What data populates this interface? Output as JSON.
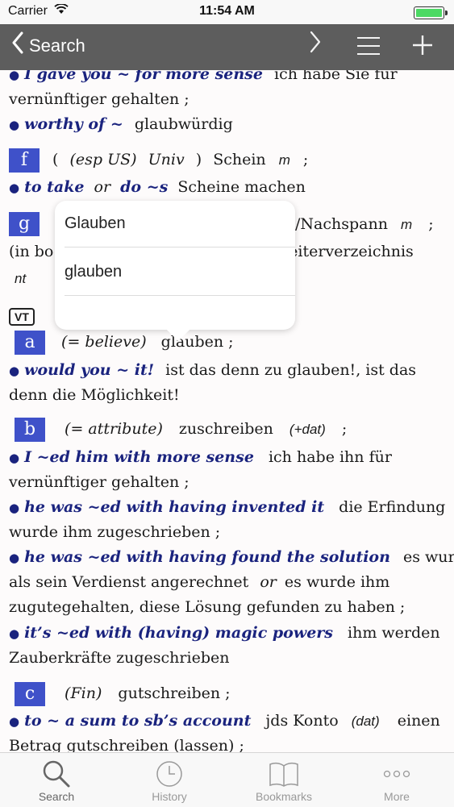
{
  "status": {
    "carrier": "Carrier",
    "time": "11:54 AM"
  },
  "nav": {
    "back_label": "Search"
  },
  "content": {
    "l1_en": "I gave you ~ for more sense",
    "l1_de": "ich habe Sie für",
    "l2": "vernünftiger gehalten ;",
    "l3_en": "worthy of ~",
    "l3_de": "glaubwürdig",
    "f_badge": "f",
    "f_paren_open": "(",
    "f_esp": "(esp US)",
    "f_univ": "Univ",
    "f_paren_close": ")",
    "f_word": "Schein",
    "f_gender": "m",
    "f_semi": ";",
    "l5_en1": "to take",
    "l5_or": "or",
    "l5_en2": "do ~s",
    "l5_de": "Scheine machen",
    "g_badge": "g",
    "g_text": "/Nachspann",
    "g_gender": "m",
    "g_semi": ";",
    "l7_left": "(in bo",
    "l7_right": "beiterverzeichnis",
    "l8": "nt",
    "vt_label": "VT",
    "a_badge": "a",
    "a_paren": "(= believe)",
    "a_word": "glauben ;",
    "l10_en": "would you ~ it!",
    "l10_de": "ist das denn zu glauben!, ist das",
    "l11": "denn die Möglichkeit!",
    "b_badge": "b",
    "b_paren": "(= attribute)",
    "b_word": "zuschreiben",
    "b_dat": "(+dat)",
    "b_semi": ";",
    "l13_en": "I ~ed him with more sense",
    "l13_de": "ich habe ihn für",
    "l14": "vernünftiger gehalten ;",
    "l15_en": "he was ~ed with having invented it",
    "l15_de": "die Erfindung",
    "l16": "wurde ihm zugeschrieben ;",
    "l17_en": "he was ~ed with having found the solution",
    "l17_de": "es wurde",
    "l18_a": "als sein Verdienst angerechnet",
    "l18_or": "or",
    "l18_b": "es wurde ihm",
    "l19": "zugutegehalten, diese Lösung gefunden zu haben ;",
    "l20_en": "it’s ~ed with (having) magic powers",
    "l20_de": "ihm werden",
    "l21": "Zauberkräfte zugeschrieben",
    "c_badge": "c",
    "c_paren": "(Fin)",
    "c_word": "gutschreiben ;",
    "l23_en": "to ~ a sum to sb’s account",
    "l23_de": "jds Konto",
    "l23_dat": "(dat)",
    "l23_end": "einen",
    "l24": "Betrag gutschreiben (lassen) ;"
  },
  "popup": {
    "options": [
      "Glauben",
      "glauben"
    ]
  },
  "tabs": [
    {
      "label": "Search",
      "icon": "search-icon"
    },
    {
      "label": "History",
      "icon": "clock-icon"
    },
    {
      "label": "Bookmarks",
      "icon": "book-icon"
    },
    {
      "label": "More",
      "icon": "more-icon"
    }
  ]
}
